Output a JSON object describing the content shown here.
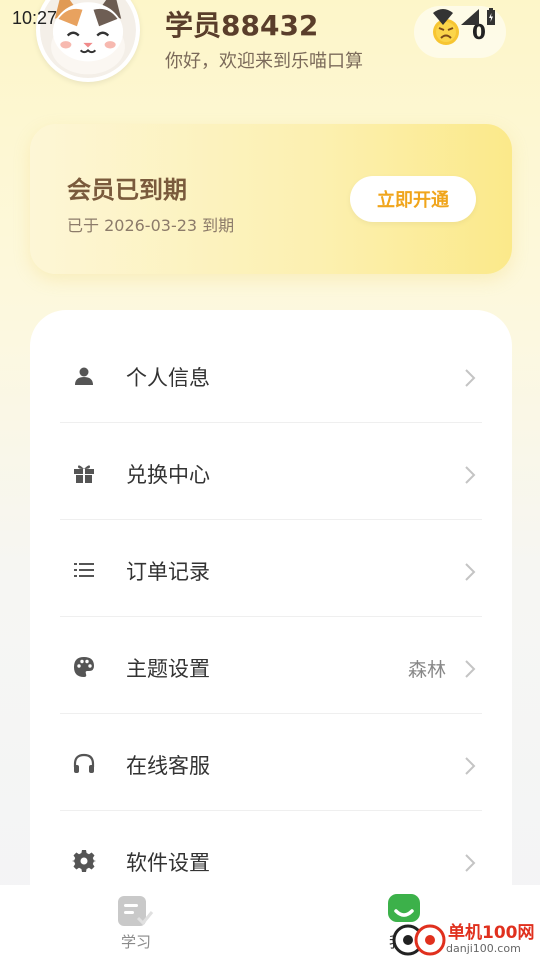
{
  "status_bar": {
    "time": "10:27",
    "icons": [
      "wifi-icon",
      "signal-icon",
      "battery-icon"
    ]
  },
  "profile": {
    "username": "学员88432",
    "greeting": "你好，欢迎来到乐喵口算",
    "avatar_icon": "cat-avatar"
  },
  "coins": {
    "icon": "grumpy-coin-icon",
    "count": "0"
  },
  "membership": {
    "title": "会员已到期",
    "subtitle": "已于 2026-03-23 到期",
    "button_label": "立即开通",
    "accent": "#f0a51c"
  },
  "menu": {
    "items": [
      {
        "icon": "person-icon",
        "label": "个人信息",
        "value": ""
      },
      {
        "icon": "gift-icon",
        "label": "兑换中心",
        "value": ""
      },
      {
        "icon": "list-icon",
        "label": "订单记录",
        "value": ""
      },
      {
        "icon": "palette-icon",
        "label": "主题设置",
        "value": "森林"
      },
      {
        "icon": "headphones-icon",
        "label": "在线客服",
        "value": ""
      },
      {
        "icon": "gear-icon",
        "label": "软件设置",
        "value": ""
      }
    ]
  },
  "bottom_nav": {
    "tabs": [
      {
        "label": "学习",
        "icon": "learn-icon",
        "active": false
      },
      {
        "label": "我的",
        "icon": "mine-icon",
        "active": true
      }
    ],
    "active_color": "#3cb14a"
  },
  "watermark": {
    "text": "单机100网",
    "url": "danji100.com"
  }
}
